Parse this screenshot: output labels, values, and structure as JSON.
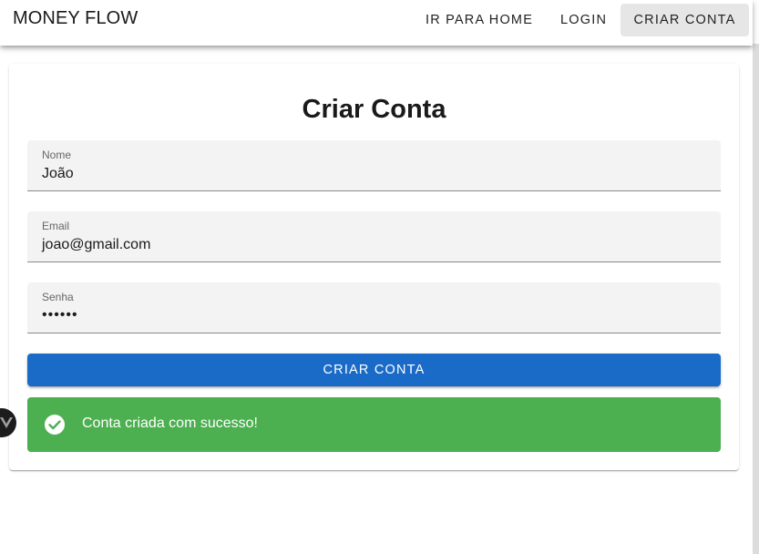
{
  "appbar": {
    "brand": "MONEY FLOW",
    "nav": {
      "home_label": "IR PARA HOME",
      "login_label": "LOGIN",
      "signup_label": "CRIAR CONTA"
    }
  },
  "form": {
    "title": "Criar Conta",
    "fields": {
      "nome": {
        "label": "Nome",
        "value": "João"
      },
      "email": {
        "label": "Email",
        "value": "joao@gmail.com"
      },
      "senha": {
        "label": "Senha",
        "value": "••••••"
      }
    },
    "submit_label": "CRIAR CONTA"
  },
  "alert": {
    "type": "success",
    "icon": "check-circle-icon",
    "message": "Conta criada com sucesso!",
    "color": "#4caf50"
  },
  "colors": {
    "primary": "#1a6bc8",
    "success": "#4caf50",
    "active_nav_bg": "#e6e6e6"
  },
  "devtools": {
    "icon": "vue-logo-icon"
  }
}
